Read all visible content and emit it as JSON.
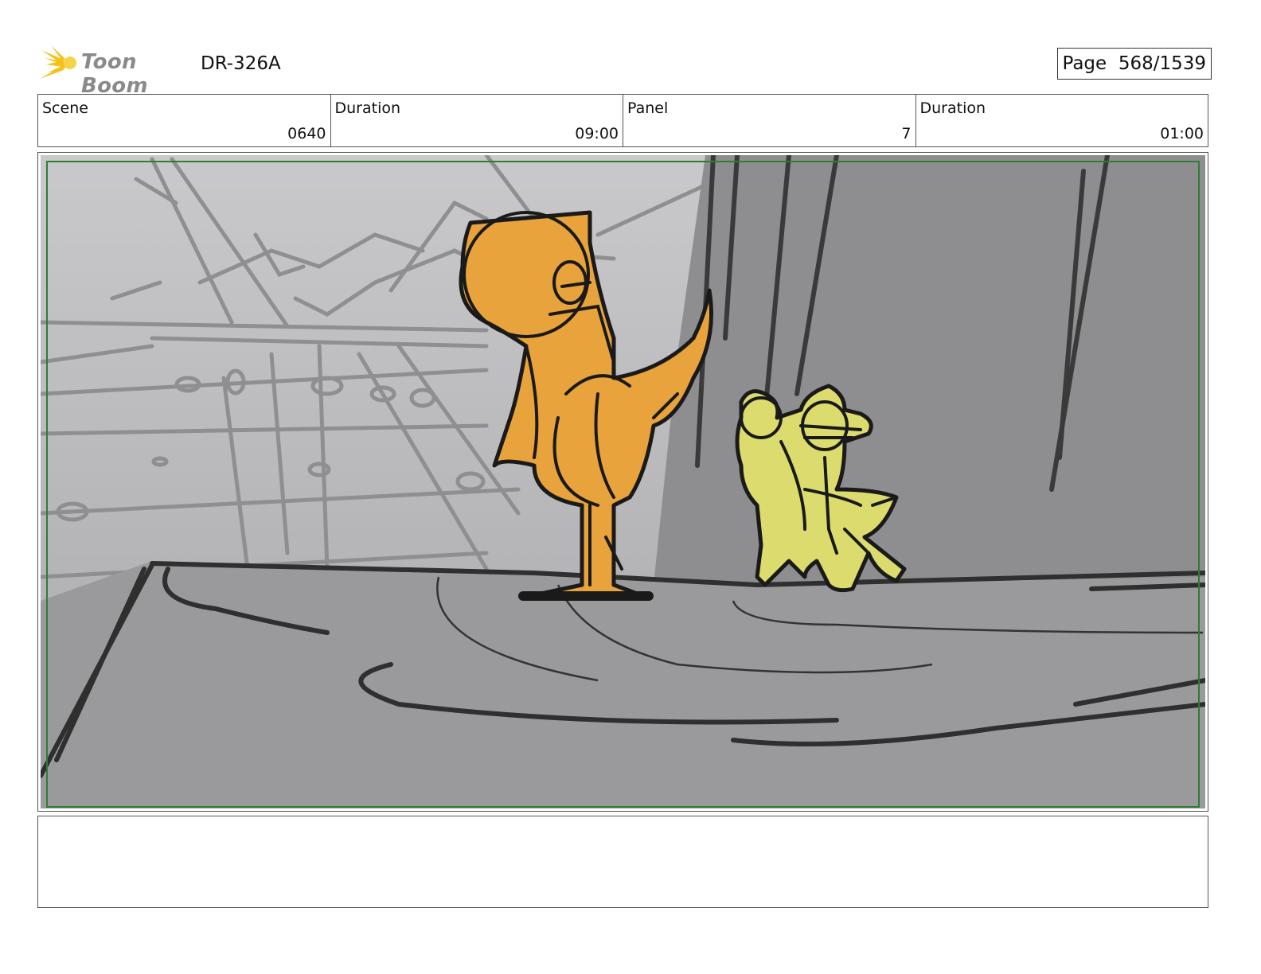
{
  "header": {
    "logo_text": "Toon Boom",
    "doc_id": "DR-326A",
    "page_label": "Page",
    "page_value": "568/1539"
  },
  "info": [
    {
      "label": "Scene",
      "value": "0640"
    },
    {
      "label": "Duration",
      "value": "09:00"
    },
    {
      "label": "Panel",
      "value": "7"
    },
    {
      "label": "Duration",
      "value": "01:00"
    }
  ],
  "colors": {
    "safe_frame": "#2e7d32",
    "orange_character": "#e8a33c",
    "yellow_character": "#dcdc6e",
    "logo_burst": "#f2c21b"
  },
  "notes": ""
}
